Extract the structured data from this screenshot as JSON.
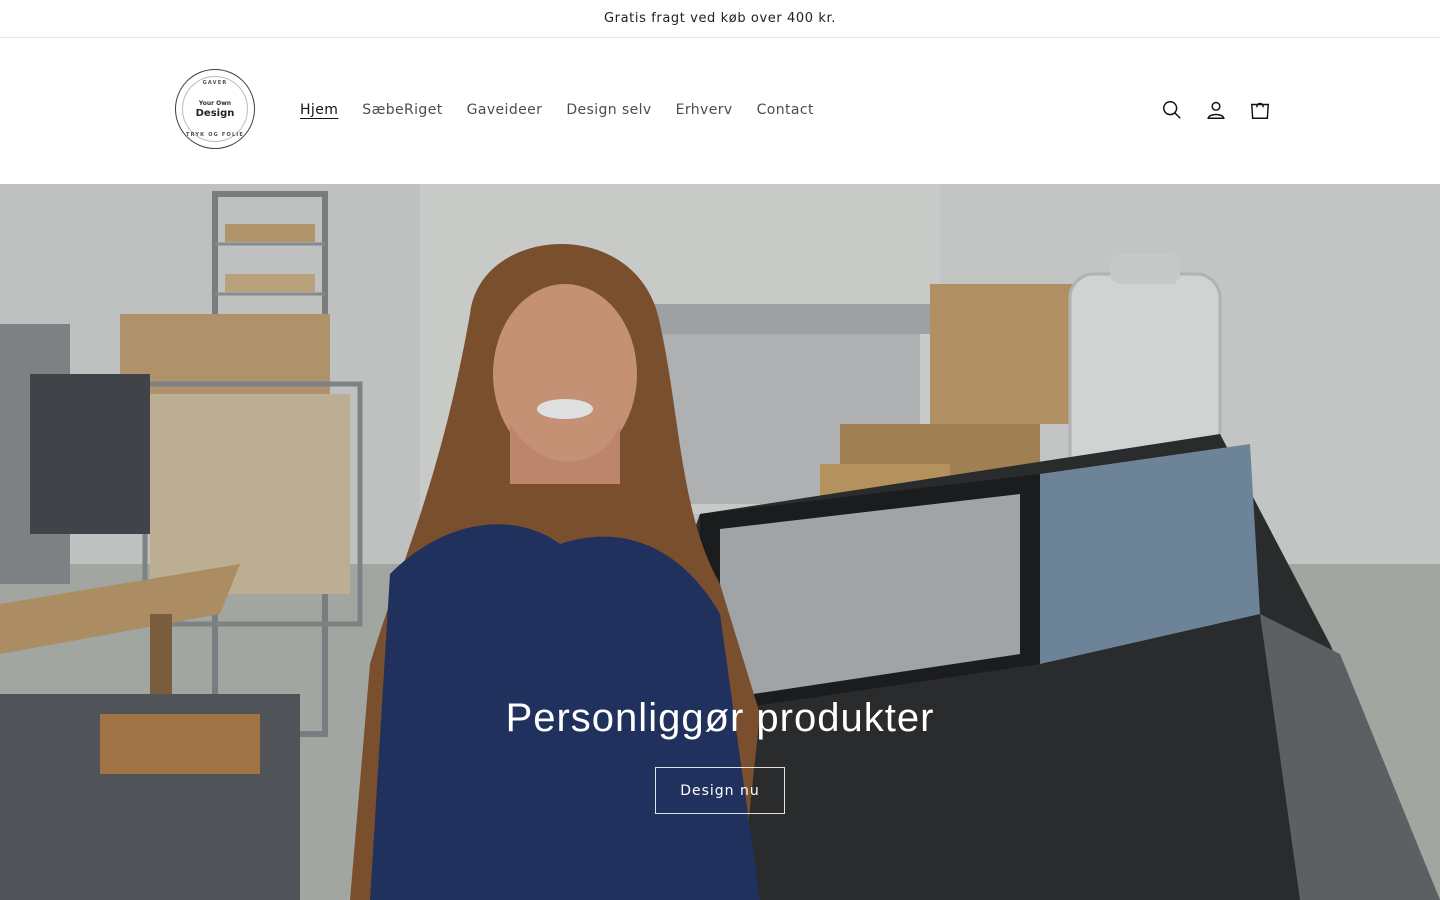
{
  "announcement": {
    "text": "Gratis fragt ved køb over 400 kr."
  },
  "logo": {
    "top_text": "GAVER",
    "line1": "Your Own",
    "line2": "Design",
    "bottom_text": "TRYK OG FOLIE"
  },
  "nav": {
    "items": [
      {
        "label": "Hjem",
        "active": true
      },
      {
        "label": "SæbeRiget",
        "active": false
      },
      {
        "label": "Gaveideer",
        "active": false
      },
      {
        "label": "Design selv",
        "active": false
      },
      {
        "label": "Erhverv",
        "active": false
      },
      {
        "label": "Contact",
        "active": false
      }
    ]
  },
  "header_icons": [
    "search-icon",
    "account-icon",
    "cart-icon"
  ],
  "hero": {
    "title": "Personliggør produkter",
    "button_label": "Design nu"
  },
  "colors": {
    "text": "#121212",
    "nav_text": "#4d4d4d",
    "hero_text": "#ffffff",
    "border": "#e6e6e6"
  }
}
